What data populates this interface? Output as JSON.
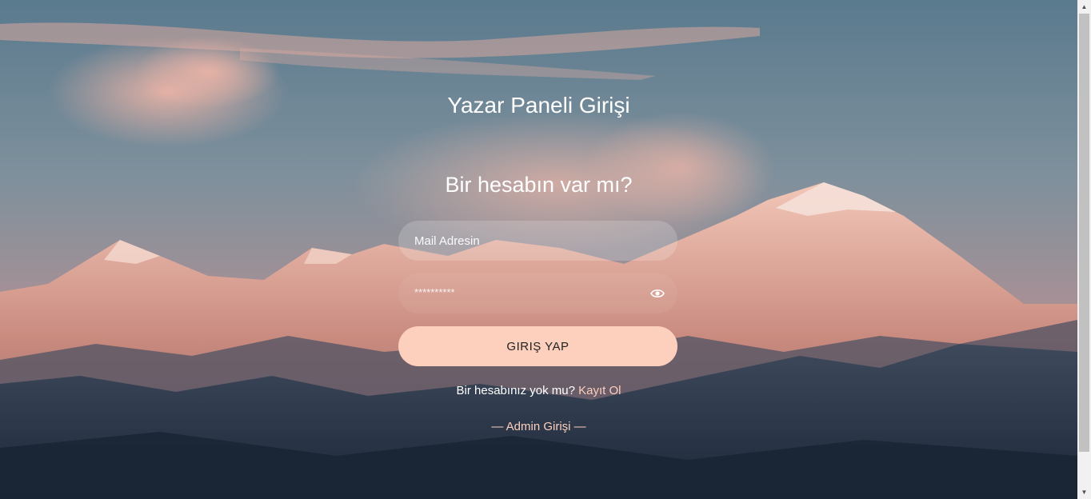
{
  "page": {
    "title": "Yazar Paneli Girişi",
    "subtitle": "Bir hesabın var mı?"
  },
  "form": {
    "email_placeholder": "Mail Adresin",
    "password_mask": "**********",
    "submit_label": "GIRIŞ YAP"
  },
  "links": {
    "register_prompt": "Bir hesabınız yok mu?",
    "register_label": "Kayıt Ol",
    "admin_label": "— Admin Girişi —"
  },
  "icons": {
    "password_toggle": "eye-icon"
  },
  "colors": {
    "accent": "#fdcfbd",
    "text": "#ffffff"
  }
}
